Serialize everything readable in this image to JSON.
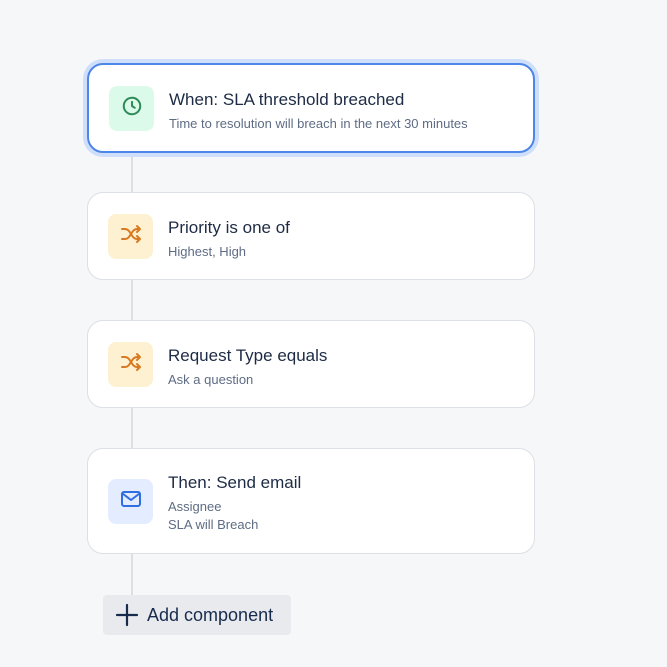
{
  "rule": {
    "components": [
      {
        "icon": "clock-icon",
        "title": "When: SLA threshold breached",
        "lines": [
          "Time to resolution will breach in the next 30 minutes"
        ],
        "selected": true
      },
      {
        "icon": "shuffle-icon",
        "title": "Priority is one of",
        "lines": [
          "Highest, High"
        ]
      },
      {
        "icon": "shuffle-icon",
        "title": "Request Type equals",
        "lines": [
          "Ask a question"
        ]
      },
      {
        "icon": "mail-icon",
        "title": "Then: Send email",
        "lines": [
          "Assignee",
          "SLA will Breach"
        ]
      }
    ],
    "add_component_label": "Add component"
  },
  "colors": {
    "selected_border": "#4c86e8",
    "trigger_icon": "#2e8b57",
    "condition_icon": "#d97a22",
    "action_icon": "#2f6fdf"
  }
}
